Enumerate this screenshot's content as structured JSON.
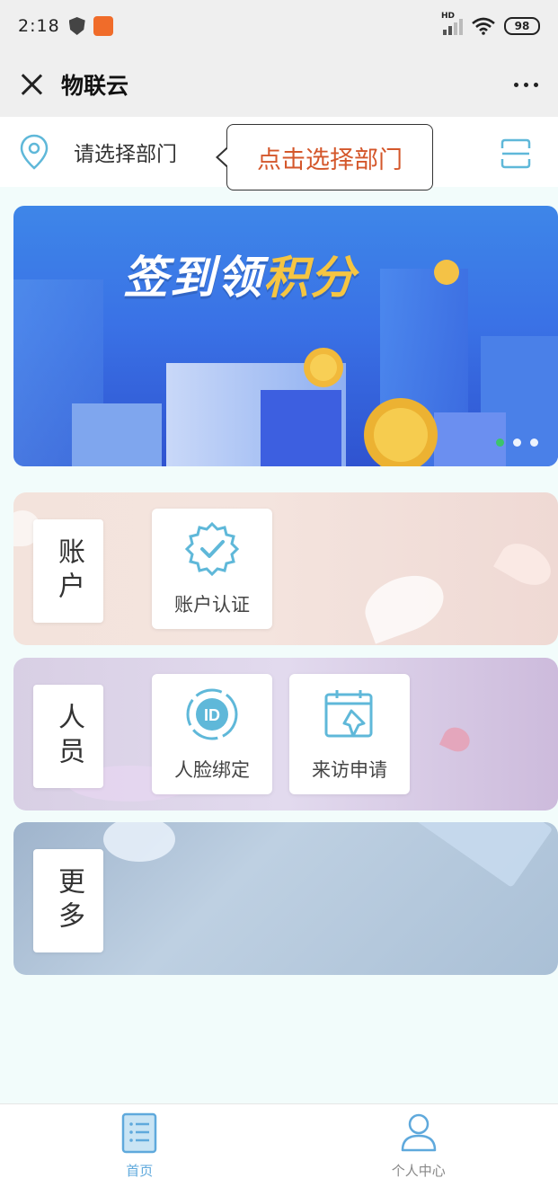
{
  "status_bar": {
    "time": "2:18",
    "battery": "98",
    "network": "HD"
  },
  "header": {
    "title": "物联云"
  },
  "department": {
    "placeholder": "请选择部门",
    "tooltip": "点击选择部门"
  },
  "banner": {
    "title_plain": "签到领",
    "title_highlight": "积分",
    "slide_count": 3,
    "active_slide": 1
  },
  "sections": {
    "account": {
      "label": "账户",
      "tiles": [
        {
          "label": "账户认证",
          "icon": "verified-badge-icon"
        }
      ]
    },
    "people": {
      "label": "人员",
      "tiles": [
        {
          "label": "人脸绑定",
          "icon": "face-id-icon"
        },
        {
          "label": "来访申请",
          "icon": "calendar-pin-icon"
        }
      ]
    },
    "more": {
      "label": "更多"
    }
  },
  "bottom_nav": {
    "items": [
      {
        "label": "首页",
        "icon": "home-list-icon",
        "active": true
      },
      {
        "label": "个人中心",
        "icon": "person-icon",
        "active": false
      }
    ]
  },
  "colors": {
    "accent": "#5fb8d9",
    "tooltip_text": "#d4572b",
    "banner_gold": "#f5c542",
    "active_dot": "#3cc46b"
  }
}
